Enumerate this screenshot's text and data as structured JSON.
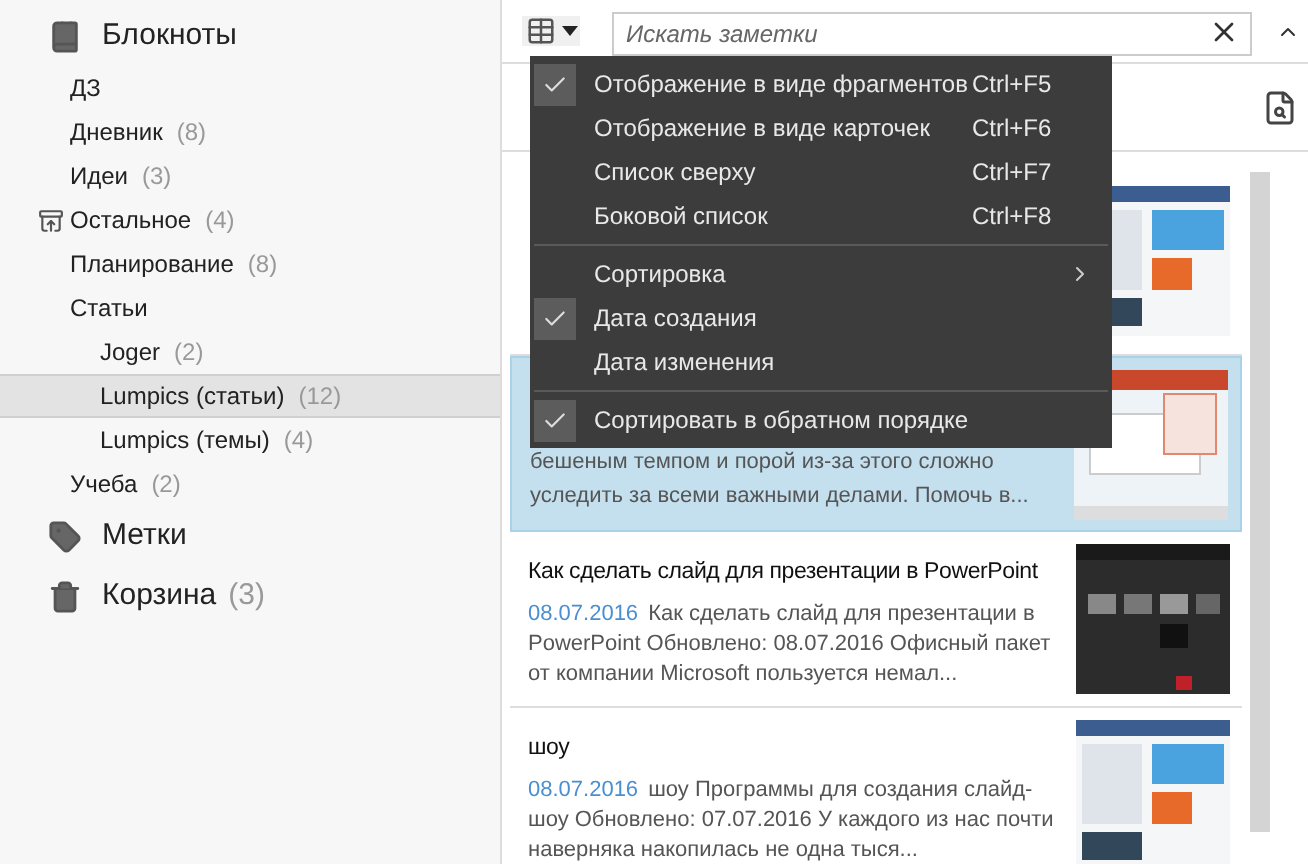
{
  "sidebar": {
    "sections": [
      {
        "kind": "notebooks",
        "title": "Блокноты",
        "items": [
          {
            "name": "ДЗ",
            "local": false,
            "selected": false
          },
          {
            "name": "Дневник",
            "count": "(8)",
            "local": false,
            "selected": false
          },
          {
            "name": "Идеи",
            "count": "(3)",
            "local": false,
            "selected": false
          },
          {
            "name": "Остальное",
            "count": "(4)",
            "local": true,
            "selected": false
          },
          {
            "name": "Планирование",
            "count": "(8)",
            "local": false,
            "selected": false
          },
          {
            "name": "Статьи",
            "local": false,
            "selected": false,
            "children": [
              {
                "name": "Joger",
                "count": "(2)",
                "local": false,
                "selected": false
              },
              {
                "name": "Lumpics (статьи)",
                "count": "(12)",
                "local": false,
                "selected": true
              },
              {
                "name": "Lumpics (темы)",
                "count": "(4)",
                "local": false,
                "selected": false
              }
            ]
          },
          {
            "name": "Учеба",
            "count": "(2)",
            "local": false,
            "selected": false
          }
        ]
      },
      {
        "kind": "tags",
        "title": "Метки"
      },
      {
        "kind": "trash",
        "title": "Корзина",
        "count": "(3)"
      }
    ]
  },
  "search": {
    "placeholder": "Искать заметки"
  },
  "view_menu": {
    "groups": [
      [
        {
          "label": "Отображение в виде фрагментов",
          "shortcut": "Ctrl+F5",
          "checked": true,
          "kind": "item"
        },
        {
          "label": "Отображение в виде карточек",
          "shortcut": "Ctrl+F6",
          "checked": false,
          "kind": "item"
        },
        {
          "label": "Список сверху",
          "shortcut": "Ctrl+F7",
          "checked": false,
          "kind": "item"
        },
        {
          "label": "Боковой список",
          "shortcut": "Ctrl+F8",
          "checked": false,
          "kind": "item"
        }
      ],
      [
        {
          "label": "Сортировка",
          "checked": false,
          "kind": "submenu"
        },
        {
          "label": "Дата создания",
          "checked": true,
          "kind": "item"
        },
        {
          "label": "Дата изменения",
          "checked": false,
          "kind": "item"
        }
      ],
      [
        {
          "label": "Сортировать в обратном порядке",
          "checked": true,
          "kind": "item"
        }
      ]
    ]
  },
  "notes": [
    {
      "selected": false,
      "thumbnail": {
        "kind": "picture"
      }
    },
    {
      "selected": true,
      "snippet_lines": [
        "бешеным темпом и порой из-за этого сложно",
        "уследить за всеми важными делами. Помочь в..."
      ],
      "thumbnail": {
        "kind": "picture"
      }
    },
    {
      "selected": false,
      "title": "Как сделать слайд для презентации в PowerPoint",
      "date": "08.07.2016",
      "snippet": "Как сделать слайд для презентации в PowerPoint Обновлено: 08.07.2016 Офисный пакет от компании Microsoft пользуется немал...",
      "thumbnail": {
        "kind": "picture"
      }
    },
    {
      "selected": false,
      "title": "шоу",
      "date": "08.07.2016",
      "snippet": "шоу Программы для создания слайд-шоу Обновлено: 07.07.2016 У каждого из нас почти наверняка накопилась не одна тыся...",
      "thumbnail": {
        "kind": "picture"
      }
    }
  ]
}
